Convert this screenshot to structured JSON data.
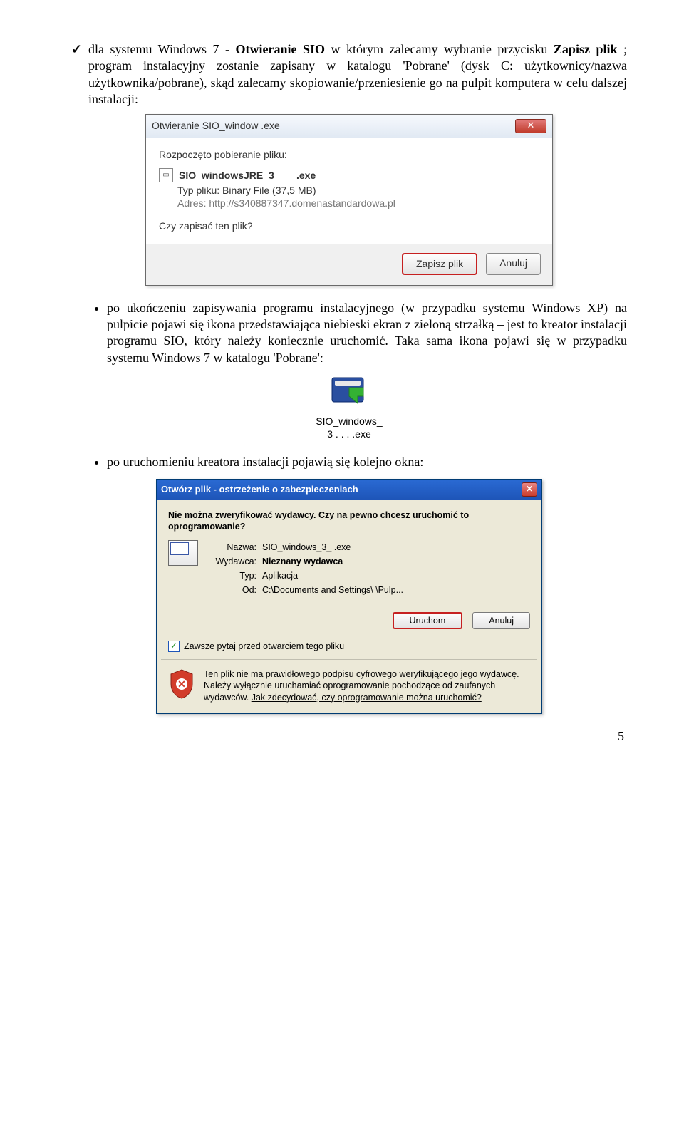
{
  "para1_prefix": "dla systemu Windows 7 - ",
  "para1_bold1": "Otwieranie SIO",
  "para1_mid1": " w którym zalecamy wybranie przycisku ",
  "para1_bold2": "Zapisz plik",
  "para1_rest": "; program instalacyjny zostanie zapisany w katalogu 'Pobrane' (dysk C: użytkownicy/nazwa użytkownika/pobrane), skąd zalecamy skopiowanie/przeniesienie go na pulpit komputera w celu dalszej instalacji:",
  "win7": {
    "title": "Otwieranie SIO_window            .exe",
    "line1": "Rozpoczęto pobieranie pliku:",
    "filename": "SIO_windowsJRE_3_ _ _.exe",
    "type_label": "Typ pliku:",
    "type_value": "Binary File (37,5 MB)",
    "addr_label": "Adres:",
    "addr_value": "http://s340887347.domenastandardowa.pl",
    "question": "Czy zapisać ten plik?",
    "btn_save": "Zapisz plik",
    "btn_cancel": "Anuluj"
  },
  "bullet1": "po ukończeniu zapisywania programu instalacyjnego (w przypadku systemu Windows XP) na pulpicie pojawi się ikona przedstawiająca niebieski ekran z zieloną strzałką – jest to kreator instalacji programu SIO, który należy koniecznie uruchomić. Taka sama ikona pojawi się w przypadku systemu Windows 7 w katalogu 'Pobrane':",
  "desktop_icon_label_l1": "SIO_windows_",
  "desktop_icon_label_l2": "3 . . . .exe",
  "bullet2": "po uruchomieniu kreatora instalacji pojawią się kolejno okna:",
  "xp": {
    "title": "Otwórz plik - ostrzeżenie o zabezpieczeniach",
    "q1": "Nie można zweryfikować wydawcy. Czy na pewno chcesz uruchomić to oprogramowanie?",
    "name_label": "Nazwa:",
    "name_value": "SIO_windows_3_    .exe",
    "pub_label": "Wydawca:",
    "pub_value": "Nieznany wydawca",
    "type_label": "Typ:",
    "type_value": "Aplikacja",
    "from_label": "Od:",
    "from_value": "C:\\Documents and Settings\\                      \\Pulp...",
    "btn_run": "Uruchom",
    "btn_cancel": "Anuluj",
    "check_label": "Zawsze pytaj przed otwarciem tego pliku",
    "warn_text": "Ten plik nie ma prawidłowego podpisu cyfrowego weryfikującego jego wydawcę. Należy wyłącznie uruchamiać oprogramowanie pochodzące od zaufanych wydawców. ",
    "warn_link": "Jak zdecydować, czy oprogramowanie można uruchomić?"
  },
  "page_number": "5"
}
